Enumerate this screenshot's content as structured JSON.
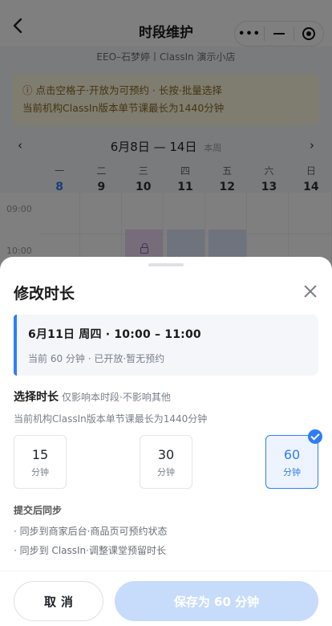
{
  "nav": {
    "back_icon": "chevron-left-icon",
    "title": "时段维护",
    "capsule": {
      "more": "•••",
      "minimize_icon": "minus-icon",
      "close_icon": "target-icon"
    }
  },
  "shop_name": "EEO–石梦婷丨ClassIn 演示小店",
  "notice": {
    "line1": "ⓘ 点击空格子·开放为可预约 · 长按·批量选择",
    "line2": "当前机构ClassIn版本单节课最长为1440分钟"
  },
  "week": {
    "range": "6月8日 — 14日",
    "tag": "本周",
    "prev": "‹",
    "next": "›",
    "days": [
      {
        "name": "一",
        "num": "8",
        "today": true
      },
      {
        "name": "二",
        "num": "9"
      },
      {
        "name": "三",
        "num": "10"
      },
      {
        "name": "四",
        "num": "11"
      },
      {
        "name": "五",
        "num": "12"
      },
      {
        "name": "六",
        "num": "13"
      },
      {
        "name": "日",
        "num": "14"
      }
    ],
    "times": [
      "09:00",
      "10:00"
    ]
  },
  "sheet": {
    "title": "修改时长",
    "info": {
      "main": "6月11日 周四 · 10:00 – 11:00",
      "sub": "当前 60 分钟 · 已开放·暂无预约"
    },
    "section_title": "选择时长",
    "section_hint": "仅影响本时段·不影响其他",
    "limit_note": "当前机构ClassIn版本单节课最长为1440分钟",
    "options": [
      {
        "value": "15",
        "unit": "分钟",
        "selected": false
      },
      {
        "value": "30",
        "unit": "分钟",
        "selected": false
      },
      {
        "value": "60",
        "unit": "分钟",
        "selected": true
      }
    ],
    "sync_title": "提交后同步",
    "sync_items": [
      "· 同步到商家后台·商品页可预约状态",
      "· 同步到 ClassIn·调整课堂预留时长"
    ],
    "cancel_label": "取消",
    "save_label": "保存为 60 分钟"
  },
  "colors": {
    "accent": "#2f7df6",
    "save_disabled": "#c7dcfb"
  }
}
